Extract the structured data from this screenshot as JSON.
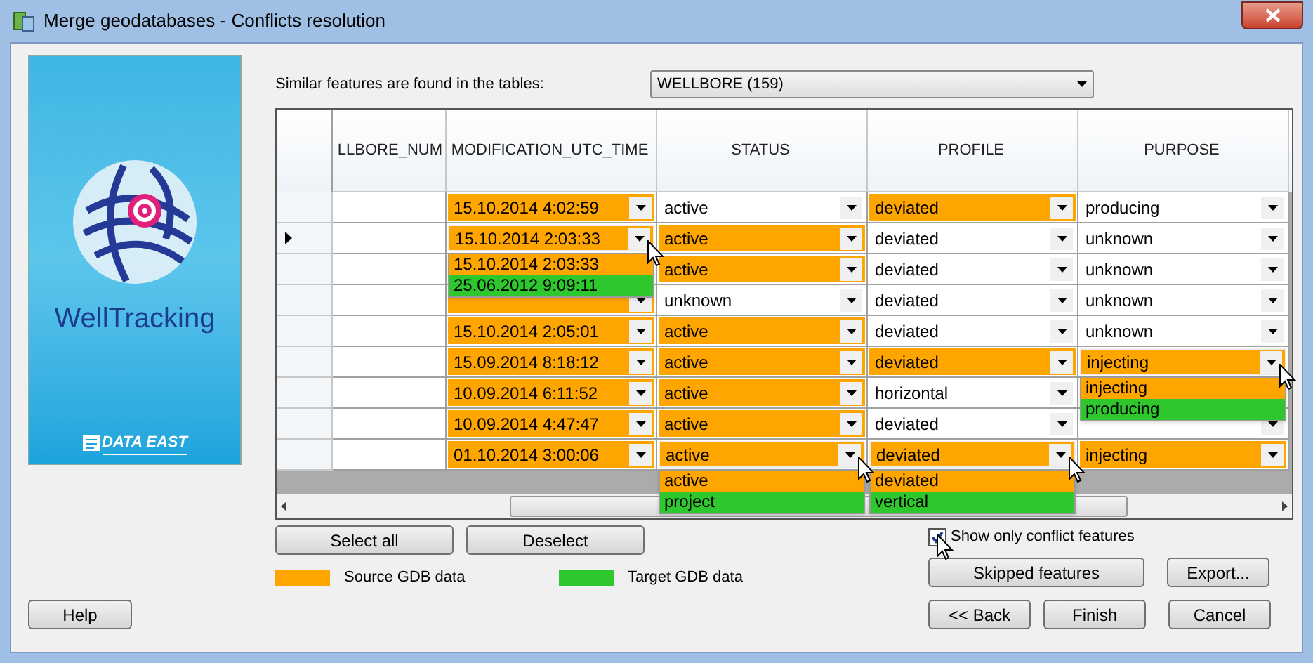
{
  "window": {
    "title": "Merge geodatabases - Conflicts resolution"
  },
  "banner": {
    "product": "WellTracking",
    "company": "DATA EAST"
  },
  "tables_label": "Similar features are found in the tables:",
  "table_select": {
    "value": "WELLBORE (159)"
  },
  "columns": [
    "LLBORE_NUM",
    "MODIFICATION_UTC_TIME",
    "STATUS",
    "PROFILE",
    "PURPOSE"
  ],
  "rows": [
    {
      "selected": false,
      "cells": [
        {
          "value": "15.10.2014 4:02:59",
          "conflict": true,
          "open": false
        },
        {
          "value": "active",
          "conflict": false,
          "open": false
        },
        {
          "value": "deviated",
          "conflict": true,
          "open": false
        },
        {
          "value": "producing",
          "conflict": false,
          "open": false
        }
      ]
    },
    {
      "selected": true,
      "cells": [
        {
          "value": "15.10.2014 2:03:33",
          "conflict": true,
          "open": true,
          "options": [
            {
              "label": "15.10.2014 2:03:33",
              "kind": "source"
            },
            {
              "label": "25.06.2012 9:09:11",
              "kind": "target"
            }
          ]
        },
        {
          "value": "active",
          "conflict": true,
          "open": false
        },
        {
          "value": "deviated",
          "conflict": false,
          "open": false
        },
        {
          "value": "unknown",
          "conflict": false,
          "open": false
        }
      ]
    },
    {
      "selected": false,
      "cells": [
        {},
        {
          "value": "active",
          "conflict": true,
          "open": false
        },
        {
          "value": "deviated",
          "conflict": false,
          "open": false
        },
        {
          "value": "unknown",
          "conflict": false,
          "open": false
        }
      ]
    },
    {
      "selected": false,
      "cells": [
        {
          "conflict": true,
          "open": false
        },
        {
          "value": "unknown",
          "conflict": false,
          "open": false
        },
        {
          "value": "deviated",
          "conflict": false,
          "open": false
        },
        {
          "value": "unknown",
          "conflict": false,
          "open": false
        }
      ]
    },
    {
      "selected": false,
      "cells": [
        {
          "value": "15.10.2014 2:05:01",
          "conflict": true,
          "open": false
        },
        {
          "value": "active",
          "conflict": true,
          "open": false
        },
        {
          "value": "deviated",
          "conflict": false,
          "open": false
        },
        {
          "value": "unknown",
          "conflict": false,
          "open": false
        }
      ]
    },
    {
      "selected": false,
      "cells": [
        {
          "value": "15.09.2014 8:18:12",
          "conflict": true,
          "open": false
        },
        {
          "value": "active",
          "conflict": true,
          "open": false
        },
        {
          "value": "deviated",
          "conflict": true,
          "open": false
        },
        {
          "value": "injecting",
          "conflict": true,
          "open": true,
          "options": [
            {
              "label": "injecting",
              "kind": "source"
            },
            {
              "label": "producing",
              "kind": "target"
            }
          ]
        }
      ]
    },
    {
      "selected": false,
      "cells": [
        {
          "value": "10.09.2014 6:11:52",
          "conflict": true,
          "open": false
        },
        {
          "value": "active",
          "conflict": true,
          "open": false
        },
        {
          "value": "horizontal",
          "conflict": false,
          "open": false
        },
        {}
      ]
    },
    {
      "selected": false,
      "cells": [
        {
          "value": "10.09.2014 4:47:47",
          "conflict": true,
          "open": false
        },
        {
          "value": "active",
          "conflict": true,
          "open": false
        },
        {
          "value": "deviated",
          "conflict": false,
          "open": false
        },
        {
          "conflict": false,
          "open": false
        }
      ]
    },
    {
      "selected": false,
      "cells": [
        {
          "value": "01.10.2014 3:00:06",
          "conflict": true,
          "open": false
        },
        {
          "value": "active",
          "conflict": true,
          "open": true,
          "options": [
            {
              "label": "active",
              "kind": "source"
            },
            {
              "label": "project",
              "kind": "target"
            }
          ]
        },
        {
          "value": "deviated",
          "conflict": true,
          "open": true,
          "options": [
            {
              "label": "deviated",
              "kind": "source"
            },
            {
              "label": "vertical",
              "kind": "target"
            }
          ]
        },
        {
          "value": "injecting",
          "conflict": true,
          "open": false
        }
      ]
    }
  ],
  "buttons": {
    "select_all": "Select all",
    "deselect": "Deselect",
    "skipped": "Skipped features",
    "export": "Export...",
    "help": "Help",
    "back": "<< Back",
    "finish": "Finish",
    "cancel": "Cancel"
  },
  "legend": [
    {
      "label": "Source GDB data",
      "color": "#ffa500"
    },
    {
      "label": "Target GDB data",
      "color": "#2ec82e"
    }
  ],
  "conflict_filter": {
    "label": "Show only conflict features",
    "checked": true,
    "hovered": true
  }
}
